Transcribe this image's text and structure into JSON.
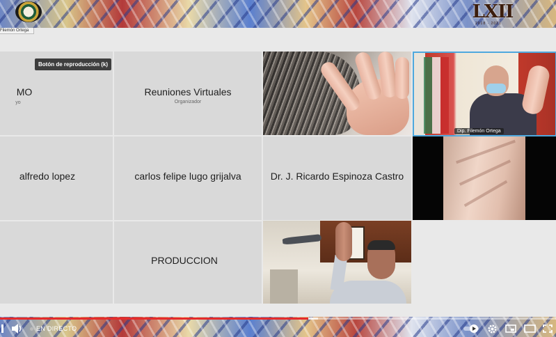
{
  "channel": {
    "emblem_icon": "congress-emblem-icon",
    "logo_text": "LXII",
    "logo_years": "2018 · 2021",
    "participant_strip": "Filemón Ortega"
  },
  "tiles": [
    {
      "name": "MO",
      "sub": "yo"
    },
    {
      "name": "Reuniones Virtuales",
      "sub": "Organizador"
    },
    {
      "name": "alfredo lopez"
    },
    {
      "name": "carlos felipe lugo grijalva"
    },
    {
      "name": "Dr. J. Ricardo Espinoza Castro"
    },
    {
      "name": "PRODUCCION"
    }
  ],
  "video_labels": {
    "filemon": "Dip. Filemón Ortega"
  },
  "tooltip": "Botón de reproducción (k)",
  "player": {
    "live_label": "EN DIRECTO",
    "progress": 0.555,
    "buffered_end": 0.572,
    "icons": [
      "play-pause-icon",
      "volume-icon",
      "live-dot-icon",
      "autoplay-toggle-icon",
      "settings-icon",
      "miniplayer-icon",
      "theater-mode-icon",
      "fullscreen-icon"
    ]
  },
  "colors": {
    "accent_red": "#e52b2b",
    "active_speaker_border": "#4ea8de",
    "tile_bg": "#d9d9d9"
  }
}
